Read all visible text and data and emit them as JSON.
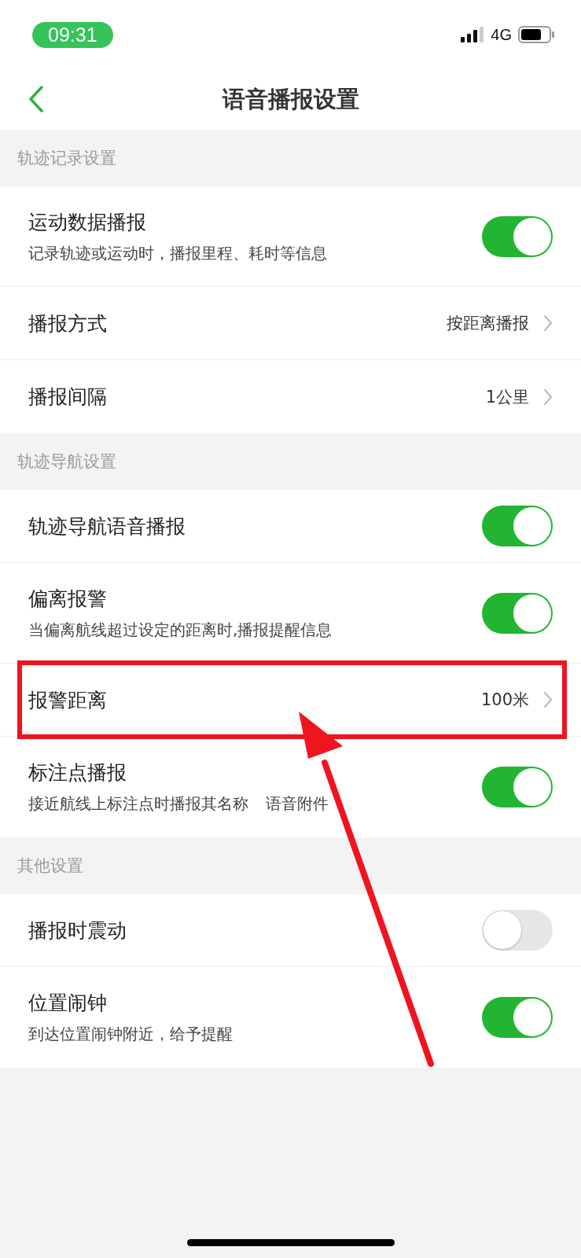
{
  "status_bar": {
    "time": "09:31",
    "network": "4G"
  },
  "nav": {
    "title": "语音播报设置"
  },
  "sections": [
    {
      "header": "轨迹记录设置",
      "rows": [
        {
          "kind": "toggle",
          "title": "运动数据播报",
          "subtitle": "记录轨迹或运动时，播报里程、耗时等信息",
          "on": true,
          "highlighted": false
        },
        {
          "kind": "link",
          "title": "播报方式",
          "value": "按距离播报",
          "highlighted": false
        },
        {
          "kind": "link",
          "title": "播报间隔",
          "value": "1公里",
          "highlighted": false
        }
      ]
    },
    {
      "header": "轨迹导航设置",
      "rows": [
        {
          "kind": "toggle",
          "title": "轨迹导航语音播报",
          "on": true,
          "highlighted": false
        },
        {
          "kind": "toggle",
          "title": "偏离报警",
          "subtitle": "当偏离航线超过设定的距离时,播报提醒信息",
          "on": true,
          "highlighted": false
        },
        {
          "kind": "link",
          "title": "报警距离",
          "value": "100米",
          "highlighted": true
        },
        {
          "kind": "toggle",
          "title": "标注点播报",
          "subtitle": "接近航线上标注点时播报其名称",
          "subtitle_after": "语音附件",
          "on": true,
          "highlighted": false
        }
      ]
    },
    {
      "header": "其他设置",
      "rows": [
        {
          "kind": "toggle",
          "title": "播报时震动",
          "on": false,
          "highlighted": false
        },
        {
          "kind": "toggle",
          "title": "位置闹钟",
          "subtitle": "到达位置闹钟附近，给予提醒",
          "on": true,
          "highlighted": false
        }
      ]
    }
  ]
}
